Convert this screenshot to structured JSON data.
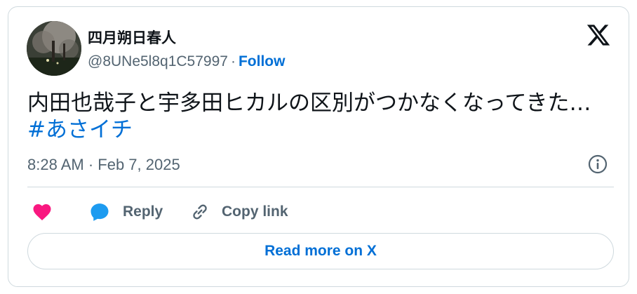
{
  "user": {
    "display_name": "四月朔日春人",
    "handle": "@8UNe5l8q1C57997",
    "separator": "·",
    "follow_label": "Follow"
  },
  "tweet": {
    "text": "内田也哉子と宇多田ヒカルの区別がつかなくなってきた…",
    "hashtag": "#あさイチ",
    "timestamp": "8:28 AM · Feb 7, 2025"
  },
  "actions": {
    "like_icon": "heart-icon",
    "reply_label": "Reply",
    "copy_link_label": "Copy link"
  },
  "read_more_label": "Read more on X",
  "colors": {
    "link_blue": "#006fd6",
    "like_red": "#f91880",
    "reply_blue": "#1d9bf0",
    "secondary_text": "#536471",
    "border": "#cfd9de"
  }
}
